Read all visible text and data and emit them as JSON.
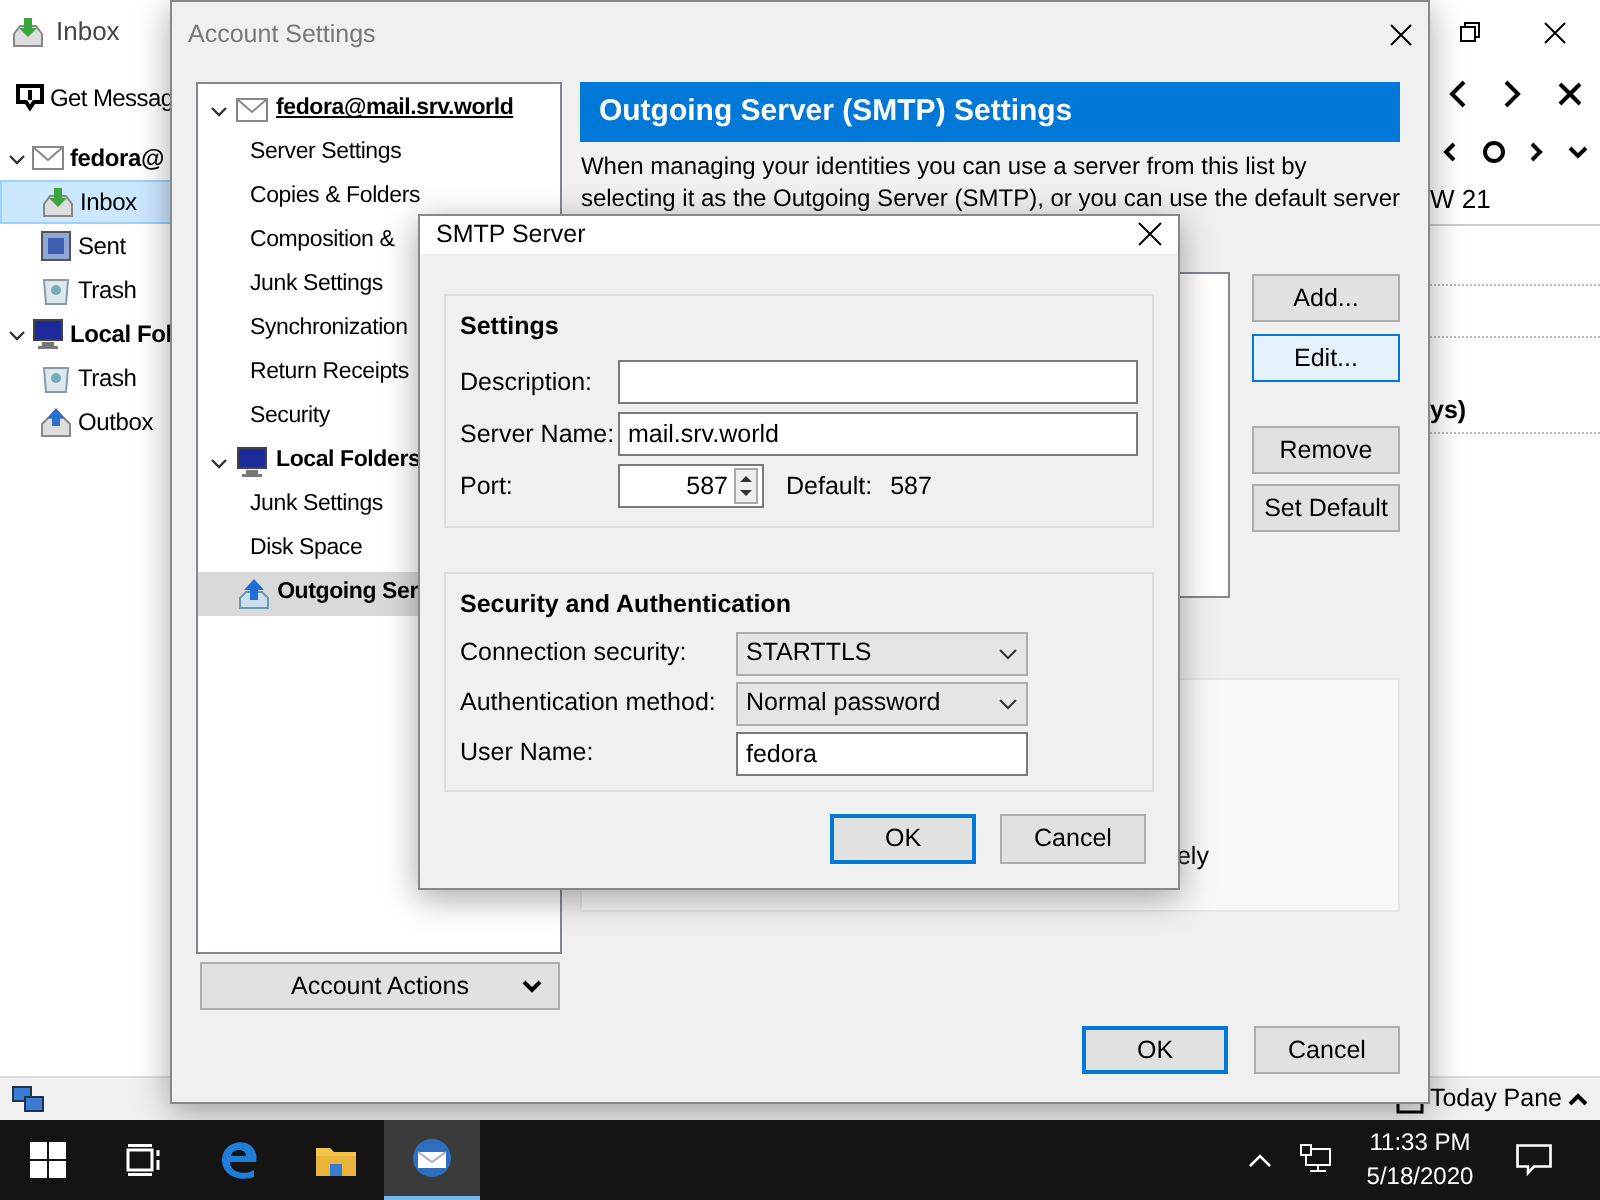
{
  "mail_window": {
    "tab_title": "Inbox",
    "toolbar_button": "Get Messag",
    "folders": [
      {
        "label": "fedora@",
        "expanded": true,
        "selected": false,
        "children": [
          {
            "label": "Inbox",
            "selected": true
          },
          {
            "label": "Sent",
            "selected": false
          },
          {
            "label": "Trash",
            "selected": false
          }
        ]
      },
      {
        "label": "Local Fol",
        "expanded": true,
        "selected": false,
        "children": [
          {
            "label": "Trash",
            "selected": false
          },
          {
            "label": "Outbox",
            "selected": false
          }
        ]
      }
    ],
    "week": "W 21",
    "fragment": "ys)",
    "today_pane": "Today Pane"
  },
  "account_settings": {
    "title": "Account Settings",
    "tree": [
      {
        "label": "fedora@mail.srv.world",
        "expanded": true,
        "selected": false,
        "children": [
          {
            "label": "Server Settings",
            "selected": false
          },
          {
            "label": "Copies & Folders",
            "selected": false
          },
          {
            "label": "Composition &",
            "selected": false
          },
          {
            "label": "Junk Settings",
            "selected": false
          },
          {
            "label": "Synchronization",
            "selected": false
          },
          {
            "label": "Return Receipts",
            "selected": false
          },
          {
            "label": "Security",
            "selected": false
          }
        ]
      },
      {
        "label": "Local Folders",
        "expanded": true,
        "selected": false,
        "children": [
          {
            "label": "Junk Settings",
            "selected": false
          },
          {
            "label": "Disk Space",
            "selected": false
          }
        ]
      },
      {
        "label": "Outgoing Ser",
        "selected": true
      }
    ],
    "account_actions": "Account Actions",
    "heading": "Outgoing Server (SMTP) Settings",
    "description_lines": [
      "When managing your identities you can use a server from this list by",
      "selecting it as the Outgoing Server (SMTP), or you can use the default server"
    ],
    "side_buttons": [
      {
        "label": "Add...",
        "highlighted": false
      },
      {
        "label": "Edit...",
        "highlighted": true
      },
      {
        "label": "Remove",
        "highlighted": false
      },
      {
        "label": "Set Default",
        "highlighted": false
      }
    ],
    "details_fragment": "ely",
    "buttons": [
      {
        "label": "OK",
        "default": true
      },
      {
        "label": "Cancel",
        "default": false
      }
    ]
  },
  "smtp_dialog": {
    "title": "SMTP Server",
    "groups": [
      {
        "heading": "Settings",
        "fields": [
          {
            "label": "Description:",
            "kind": "text"
          },
          {
            "label": "Server Name:",
            "kind": "text",
            "value": "mail.srv.world"
          },
          {
            "label": "Port:",
            "kind": "spin",
            "value": "587",
            "default_label": "Default:",
            "default_value": "587"
          }
        ]
      },
      {
        "heading": "Security and Authentication",
        "fields": [
          {
            "label": "Connection security:",
            "kind": "select",
            "value": "STARTTLS"
          },
          {
            "label": "Authentication method:",
            "kind": "select",
            "value": "Normal password"
          },
          {
            "label": "User Name:",
            "kind": "text",
            "value": "fedora"
          }
        ]
      }
    ],
    "buttons": [
      {
        "label": "OK",
        "default": true
      },
      {
        "label": "Cancel",
        "default": false
      }
    ]
  },
  "taskbar": {
    "apps": [
      {
        "kind": "windows",
        "active": false
      },
      {
        "kind": "taskview",
        "active": false
      },
      {
        "kind": "edge",
        "active": false
      },
      {
        "kind": "explorer",
        "active": false
      },
      {
        "kind": "thunderbird",
        "active": true
      }
    ],
    "time": "11:33 PM",
    "date": "5/18/2020"
  }
}
